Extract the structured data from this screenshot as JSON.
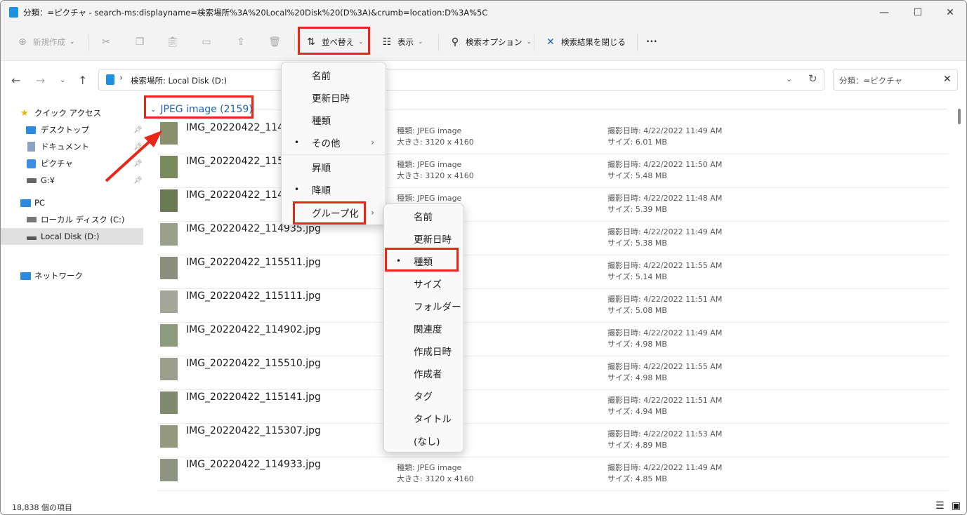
{
  "title": "分類：=ピクチャ - search-ms:displayname=検索場所%3A%20Local%20Disk%20(D%3A)&crumb=location:D%3A%5C",
  "window_controls": {
    "minimize": "—",
    "maximize": "☐",
    "close": "✕"
  },
  "toolbar": {
    "new_label": "新規作成",
    "sort_label": "並べ替え",
    "view_label": "表示",
    "search_options_label": "検索オプション",
    "close_search_label": "検索結果を閉じる",
    "more_label": "•••"
  },
  "address": {
    "path": "検索場所: Local Disk (D:)",
    "search_placeholder": "分類：=ピクチャ"
  },
  "sidebar": {
    "quick_access": "クイック アクセス",
    "desktop": "デスクトップ",
    "documents": "ドキュメント",
    "pictures": "ピクチャ",
    "g_drive": "G:¥",
    "pc": "PC",
    "local_c": "ローカル ディスク (C:)",
    "local_d": "Local Disk (D:)",
    "network": "ネットワーク"
  },
  "group_header": "JPEG image (2159)",
  "files": [
    {
      "name": "IMG_20220422_1148",
      "type": "種類: JPEG image",
      "dims": "大きさ: 3120 x 4160",
      "date": "撮影日時: 4/22/2022 11:49 AM",
      "size": "サイズ: 6.01 MB"
    },
    {
      "name": "IMG_20220422_1150",
      "type": "種類: JPEG image",
      "dims": "大きさ: 3120 x 4160",
      "date": "撮影日時: 4/22/2022 11:50 AM",
      "size": "サイズ: 5.48 MB"
    },
    {
      "name": "IMG_20220422_1148",
      "type": "種類: JPEG image",
      "dims": "",
      "date": "撮影日時: 4/22/2022 11:48 AM",
      "size": "サイズ: 5.39 MB"
    },
    {
      "name": "IMG_20220422_114935.jpg",
      "type": "",
      "dims": "",
      "date": "撮影日時: 4/22/2022 11:49 AM",
      "size": "サイズ: 5.38 MB"
    },
    {
      "name": "IMG_20220422_115511.jpg",
      "type": "",
      "dims": "",
      "date": "撮影日時: 4/22/2022 11:55 AM",
      "size": "サイズ: 5.14 MB"
    },
    {
      "name": "IMG_20220422_115111.jpg",
      "type": "",
      "dims": "",
      "date": "撮影日時: 4/22/2022 11:51 AM",
      "size": "サイズ: 5.08 MB"
    },
    {
      "name": "IMG_20220422_114902.jpg",
      "type": "",
      "dims": "",
      "date": "撮影日時: 4/22/2022 11:49 AM",
      "size": "サイズ: 4.98 MB"
    },
    {
      "name": "IMG_20220422_115510.jpg",
      "type": "",
      "dims": "",
      "date": "撮影日時: 4/22/2022 11:55 AM",
      "size": "サイズ: 4.98 MB"
    },
    {
      "name": "IMG_20220422_115141.jpg",
      "type": "",
      "dims": "",
      "date": "撮影日時: 4/22/2022 11:51 AM",
      "size": "サイズ: 4.94 MB"
    },
    {
      "name": "IMG_20220422_115307.jpg",
      "type": "",
      "dims": "",
      "date": "撮影日時: 4/22/2022 11:53 AM",
      "size": "サイズ: 4.89 MB"
    },
    {
      "name": "IMG_20220422_114933.jpg",
      "type": "種類: JPEG image",
      "dims": "大きさ: 3120 x 4160",
      "date": "撮影日時: 4/22/2022 11:49 AM",
      "size": "サイズ: 4.85 MB"
    }
  ],
  "status": {
    "count": "18,838 個の項目"
  },
  "sort_menu": {
    "items": [
      "名前",
      "更新日時",
      "種類",
      "その他",
      "昇順",
      "降順",
      "グループ化"
    ],
    "selected_sort": "その他",
    "selected_order": "降順"
  },
  "group_menu": {
    "items": [
      "名前",
      "更新日時",
      "種類",
      "サイズ",
      "フォルダー",
      "関連度",
      "作成日時",
      "作成者",
      "タグ",
      "タイトル",
      "(なし)"
    ],
    "selected": "種類"
  },
  "colors": {
    "highlight": "#e8271b",
    "accent": "#1e63b5"
  }
}
